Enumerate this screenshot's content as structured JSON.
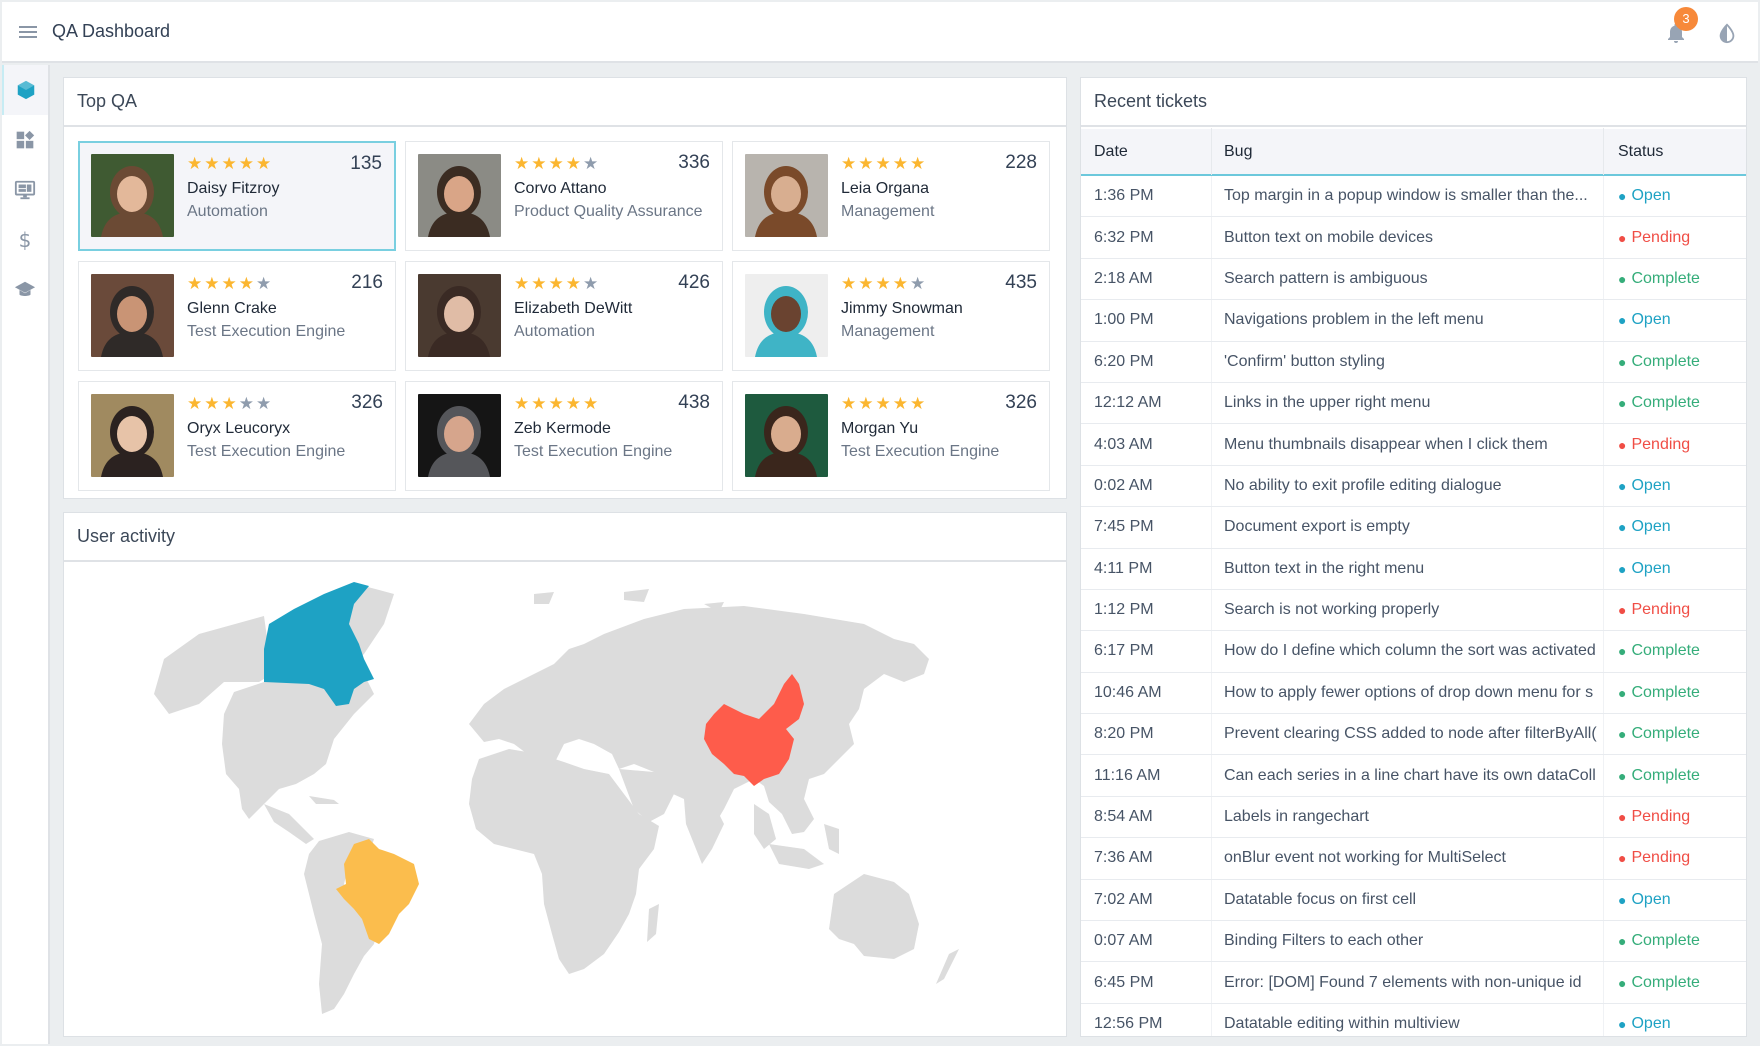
{
  "header": {
    "title": "QA Dashboard",
    "notifications_count": "3"
  },
  "sidebar": {
    "items": [
      {
        "icon": "cube-icon",
        "active": true
      },
      {
        "icon": "widgets-icon",
        "active": false
      },
      {
        "icon": "monitor-icon",
        "active": false
      },
      {
        "icon": "dollar-icon",
        "active": false
      },
      {
        "icon": "graduation-cap-icon",
        "active": false
      }
    ]
  },
  "top_qa": {
    "title": "Top QA",
    "people": [
      {
        "name": "Daisy Fitzroy",
        "role": "Automation",
        "rating": 5,
        "score": "135",
        "selected": true,
        "photo_colors": [
          "#3f5a32",
          "#6b4a34",
          "#e3b89a"
        ]
      },
      {
        "name": "Corvo Attano",
        "role": "Product Quality Assurance",
        "rating": 4,
        "score": "336",
        "photo_colors": [
          "#8b8b85",
          "#3b2c22",
          "#d9a587"
        ]
      },
      {
        "name": "Leia Organa",
        "role": "Management",
        "rating": 5,
        "score": "228",
        "photo_colors": [
          "#b8b4ae",
          "#7a4a2a",
          "#d8ae90"
        ]
      },
      {
        "name": "Glenn Crake",
        "role": "Test Execution Engine",
        "rating": 4,
        "score": "216",
        "photo_colors": [
          "#6a4a3a",
          "#2f2a28",
          "#c99475"
        ]
      },
      {
        "name": "Elizabeth DeWitt",
        "role": "Automation",
        "rating": 4,
        "score": "426",
        "photo_colors": [
          "#4a3a30",
          "#3a2a24",
          "#e0bca6"
        ]
      },
      {
        "name": "Jimmy Snowman",
        "role": "Management",
        "rating": 4,
        "score": "435",
        "photo_colors": [
          "#eeeeee",
          "#3fb4c6",
          "#6a4330"
        ]
      },
      {
        "name": "Oryx Leucoryx",
        "role": "Test Execution Engine",
        "rating": 3,
        "score": "326",
        "photo_colors": [
          "#a08a60",
          "#2b2220",
          "#e7c3a8"
        ]
      },
      {
        "name": "Zeb Kermode",
        "role": "Test Execution Engine",
        "rating": 5,
        "score": "438",
        "photo_colors": [
          "#151515",
          "#55565a",
          "#d6a58c"
        ]
      },
      {
        "name": "Morgan Yu",
        "role": "Test Execution Engine",
        "rating": 5,
        "score": "326",
        "photo_colors": [
          "#1e5a3e",
          "#3a261c",
          "#d9ac8e"
        ]
      }
    ]
  },
  "user_activity": {
    "title": "User activity",
    "highlighted_countries": [
      {
        "name": "Canada",
        "color": "#1ea2c4"
      },
      {
        "name": "Brazil",
        "color": "#fbbd4d"
      },
      {
        "name": "China",
        "color": "#fe5c4b"
      }
    ],
    "land_color": "#dcdcdc"
  },
  "tickets": {
    "title": "Recent tickets",
    "columns": {
      "date": "Date",
      "bug": "Bug",
      "status": "Status"
    },
    "status_colors": {
      "Open": "#1ea2c4",
      "Pending": "#f04d45",
      "Complete": "#35ad7a"
    },
    "rows": [
      {
        "date": "1:36 PM",
        "bug": "Top margin in a popup window is smaller than the...",
        "status": "Open"
      },
      {
        "date": "6:32 PM",
        "bug": "Button text on mobile devices",
        "status": "Pending"
      },
      {
        "date": "2:18 AM",
        "bug": "Search pattern is ambiguous",
        "status": "Complete"
      },
      {
        "date": "1:00 PM",
        "bug": "Navigations problem in the left menu",
        "status": "Open"
      },
      {
        "date": "6:20 PM",
        "bug": "'Confirm' button styling",
        "status": "Complete"
      },
      {
        "date": "12:12 AM",
        "bug": "Links in the upper right menu",
        "status": "Complete"
      },
      {
        "date": "4:03 AM",
        "bug": "Menu thumbnails disappear when I click them",
        "status": "Pending"
      },
      {
        "date": "0:02 AM",
        "bug": "No ability to exit profile editing dialogue",
        "status": "Open"
      },
      {
        "date": "7:45 PM",
        "bug": "Document export is empty",
        "status": "Open"
      },
      {
        "date": "4:11 PM",
        "bug": "Button text in the right menu",
        "status": "Open"
      },
      {
        "date": "1:12 PM",
        "bug": "Search is not working properly",
        "status": "Pending"
      },
      {
        "date": "6:17 PM",
        "bug": "How do I define which column the sort was activated",
        "status": "Complete"
      },
      {
        "date": "10:46 AM",
        "bug": "How to apply fewer options of drop down menu for s",
        "status": "Complete"
      },
      {
        "date": "8:20 PM",
        "bug": "Prevent clearing CSS added to node after filterByAll(",
        "status": "Complete"
      },
      {
        "date": "11:16 AM",
        "bug": "Can each series in a line chart have its own dataColl",
        "status": "Complete"
      },
      {
        "date": "8:54 AM",
        "bug": "Labels in rangechart",
        "status": "Pending"
      },
      {
        "date": "7:36 AM",
        "bug": "onBlur event not working for MultiSelect",
        "status": "Pending"
      },
      {
        "date": "7:02 AM",
        "bug": "Datatable focus on first cell",
        "status": "Open"
      },
      {
        "date": "0:07 AM",
        "bug": "Binding Filters to each other",
        "status": "Complete"
      },
      {
        "date": "6:45 PM",
        "bug": "Error: [DOM] Found 7 elements with non-unique id",
        "status": "Complete"
      },
      {
        "date": "12:56 PM",
        "bug": "Datatable editing within multiview",
        "status": "Open"
      }
    ]
  }
}
